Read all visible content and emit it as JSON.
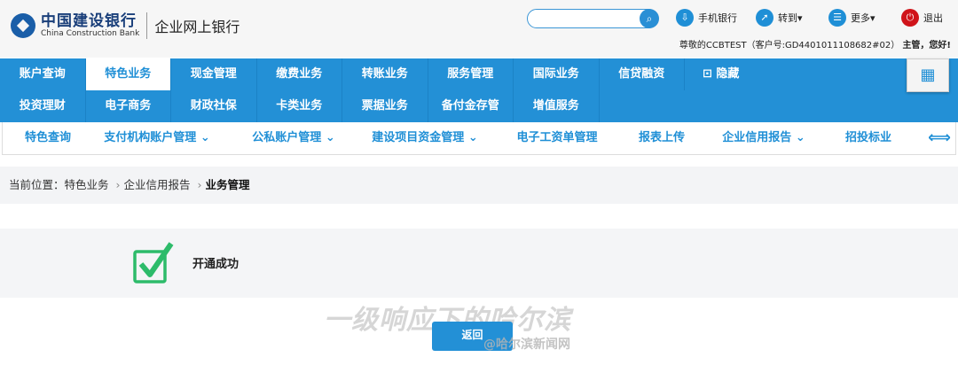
{
  "header": {
    "bank_name_cn": "中国建设银行",
    "bank_name_en": "China Construction Bank",
    "product": "企业网上银行",
    "search": {
      "placeholder": ""
    },
    "tools": [
      {
        "label": "手机银行",
        "icon": "mobile-download-icon"
      },
      {
        "label": "转到▾",
        "icon": "share-arrow-icon"
      },
      {
        "label": "更多▾",
        "icon": "list-icon"
      },
      {
        "label": "退出",
        "icon": "power-icon"
      }
    ],
    "greeting": "尊敬的CCBTEST（客户号:GD4401011108682#02）",
    "role": "主管，您好!"
  },
  "nav_row1": [
    "账户查询",
    "特色业务",
    "现金管理",
    "缴费业务",
    "转账业务",
    "服务管理",
    "国际业务",
    "信贷融资"
  ],
  "nav_hide": "隐藏",
  "nav_row2": [
    "投资理财",
    "电子商务",
    "财政社保",
    "卡类业务",
    "票据业务",
    "备付金存管",
    "增值服务"
  ],
  "active_tab": "特色业务",
  "sub_nav": [
    "特色查询",
    "支付机构账户管理 ⌄",
    "公私账户管理 ⌄",
    "建设项目资金管理 ⌄",
    "电子工资单管理",
    "报表上传",
    "企业信用报告 ⌄",
    "招投标业"
  ],
  "breadcrumb": {
    "prefix": "当前位置：",
    "items": [
      "特色业务",
      "企业信用报告"
    ],
    "current": "业务管理",
    "sep": "›"
  },
  "result": {
    "message": "开通成功",
    "icon": "success-check-icon"
  },
  "back_label": "返回",
  "watermark": {
    "headline": "一级响应下的哈尔滨",
    "source": "@哈尔滨新闻网"
  },
  "colors": {
    "brand_blue": "#2390d6",
    "success_green": "#2dbb6a"
  }
}
